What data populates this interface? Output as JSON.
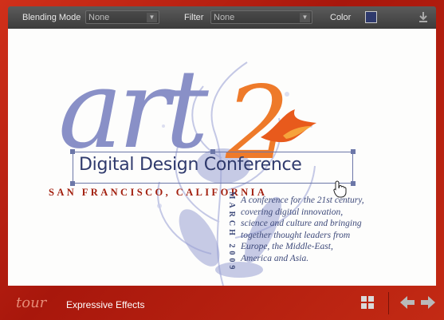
{
  "toolbar": {
    "blending_label": "Blending Mode",
    "blending_value": "None",
    "filter_label": "Filter",
    "filter_value": "None",
    "color_label": "Color",
    "color_value": "#2f3a6d"
  },
  "canvas": {
    "logo_text": "art",
    "logo_number": "2",
    "headline": "Digital Design Conference",
    "location": "SAN FRANCISCO, CALIFORNIA",
    "date": "MARCH 2009",
    "blurb_lines": [
      "A conference for the 21st century,",
      "covering digital innovation,",
      "science and culture and bringing",
      "together thought leaders from",
      "Europe, the Middle-East,",
      "America and Asia."
    ]
  },
  "bottom": {
    "tour_logo": "tour",
    "section_title": "Expressive Effects"
  },
  "icons": {
    "download": "download-icon",
    "grid": "grid-icon",
    "prev": "arrow-left-icon",
    "next": "arrow-right-icon",
    "cursor": "hand-cursor-icon"
  },
  "colors": {
    "frame": "#b51d10",
    "art": "#8990c7",
    "accent": "#ee7a2a",
    "navy": "#2f3a6d",
    "red_text": "#a21f0e"
  }
}
